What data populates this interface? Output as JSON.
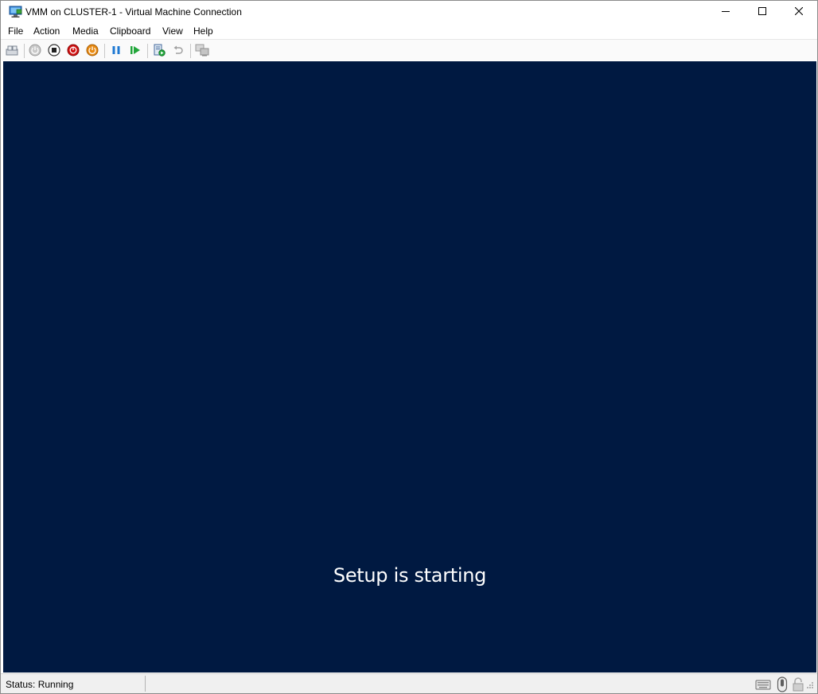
{
  "window": {
    "title": "VMM on CLUSTER-1 - Virtual Machine Connection",
    "app_icon": "monitor-icon"
  },
  "caption_buttons": {
    "minimize_icon": "minimize-icon",
    "maximize_icon": "maximize-icon",
    "close_icon": "close-icon"
  },
  "menu": {
    "items": [
      "File",
      "Action",
      "Media",
      "Clipboard",
      "View",
      "Help"
    ]
  },
  "toolbar": {
    "buttons": [
      "ctrl-alt-del-icon",
      "start-icon",
      "turn-off-icon",
      "shut-down-icon",
      "save-icon",
      "pause-icon",
      "reset-icon",
      "checkpoint-icon",
      "revert-icon",
      "enhanced-session-icon"
    ]
  },
  "vm": {
    "message": "Setup is starting",
    "background_color": "#001941"
  },
  "status": {
    "text": "Status: Running",
    "icons": [
      "keyboard-icon",
      "mouse-icon",
      "lock-icon"
    ]
  },
  "colors": {
    "stop_red": "#d01010",
    "shutdown_orange": "#e88a12",
    "pause_blue": "#1e78d2",
    "resume_green": "#22a63a"
  }
}
